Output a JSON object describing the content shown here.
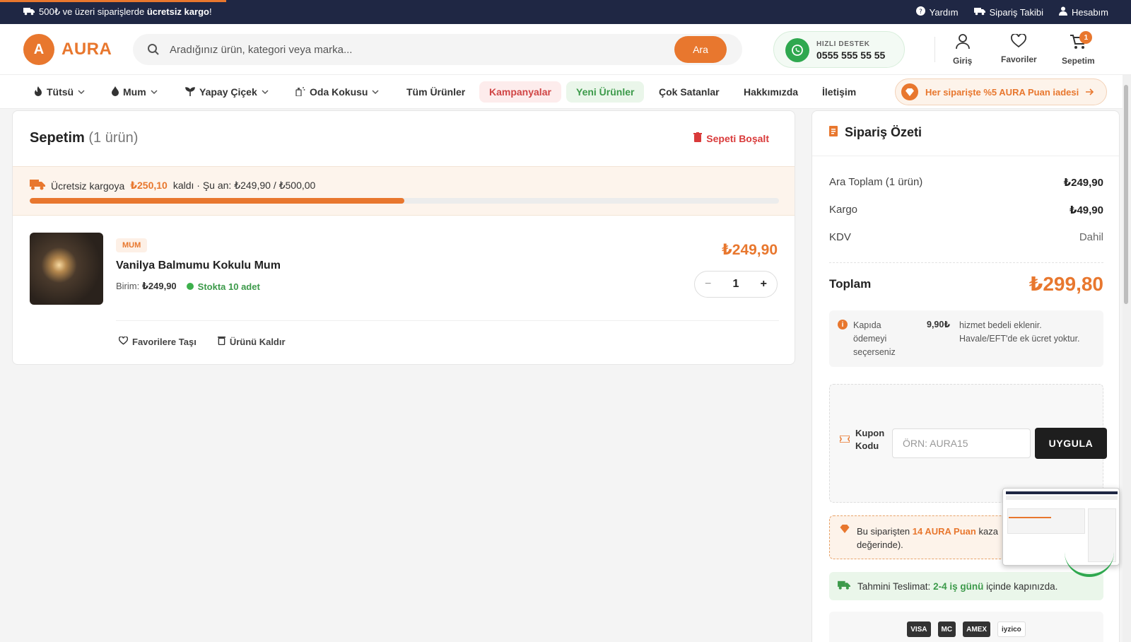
{
  "topbar": {
    "promo_prefix": "500₺ ve üzeri siparişlerde",
    "promo_bold": "ücretsiz kargo",
    "promo_suffix": "!",
    "links": {
      "help": "Yardım",
      "tracking": "Sipariş Takibi",
      "account": "Hesabım"
    }
  },
  "header": {
    "logo_letter": "A",
    "logo_name": "AURA",
    "search_placeholder": "Aradığınız ürün, kategori veya marka...",
    "search_button": "Ara",
    "support_label": "HIZLI DESTEK",
    "support_phone": "0555 555 55 55",
    "login": "Giriş",
    "favorites": "Favoriler",
    "cart": "Sepetim",
    "cart_count": "1"
  },
  "nav": {
    "items": [
      "Tütsü",
      "Mum",
      "Yapay Çiçek",
      "Oda Kokusu",
      "Tüm Ürünler",
      "Kampanyalar",
      "Yeni Ürünler",
      "Çok Satanlar",
      "Hakkımızda",
      "İletişim"
    ],
    "points_banner": "Her siparişte %5 AURA Puan iadesi"
  },
  "cart": {
    "title": "Sepetim",
    "count_text": "(1 ürün)",
    "clear": "Sepeti Boşalt",
    "free_shipping": {
      "prefix": "Ücretsiz kargoya",
      "remaining": "₺250,10",
      "suffix": "kaldı · Şu an: ₺249,90 / ₺500,00",
      "progress": 0.4998
    },
    "item": {
      "category": "MUM",
      "name": "Vanilya Balmumu Kokulu Mum",
      "unit_label": "Birim:",
      "unit_price": "₺249,90",
      "stock": "Stokta 10 adet",
      "price": "₺249,90",
      "qty": "1",
      "minus": "−",
      "plus": "+",
      "move_fav": "Favorilere Taşı",
      "remove": "Ürünü Kaldır"
    }
  },
  "summary": {
    "title": "Sipariş Özeti",
    "subtotal_label": "Ara Toplam (1 ürün)",
    "subtotal_value": "₺249,90",
    "shipping_label": "Kargo",
    "shipping_value": "₺49,90",
    "tax_label": "KDV",
    "tax_value": "Dahil",
    "total_label": "Toplam",
    "total_value": "₺299,80",
    "cod_text1": "Kapıda ödemeyi seçerseniz",
    "cod_fee": "9,90₺",
    "cod_text2": "hizmet bedeli eklenir. Havale/EFT'de ek ücret yoktur.",
    "coupon_label": "Kupon Kodu",
    "coupon_placeholder": "ÖRN: AURA15",
    "coupon_button": "UYGULA",
    "earn_prefix": "Bu siparişten",
    "earn_points": "14 AURA Puan",
    "earn_suffix": "kaza",
    "earn_line2": "değerinde).",
    "delivery_prefix": "Tahmini Teslimat:",
    "delivery_days": "2-4 iş günü",
    "delivery_suffix": "içinde kapınızda.",
    "payments": [
      "VISA",
      "MC",
      "AMEX",
      "iyzico"
    ]
  },
  "colors": {
    "accent": "#e8772e",
    "navy": "#1f2744",
    "green": "#3c9a4a",
    "red": "#d93a3a"
  }
}
